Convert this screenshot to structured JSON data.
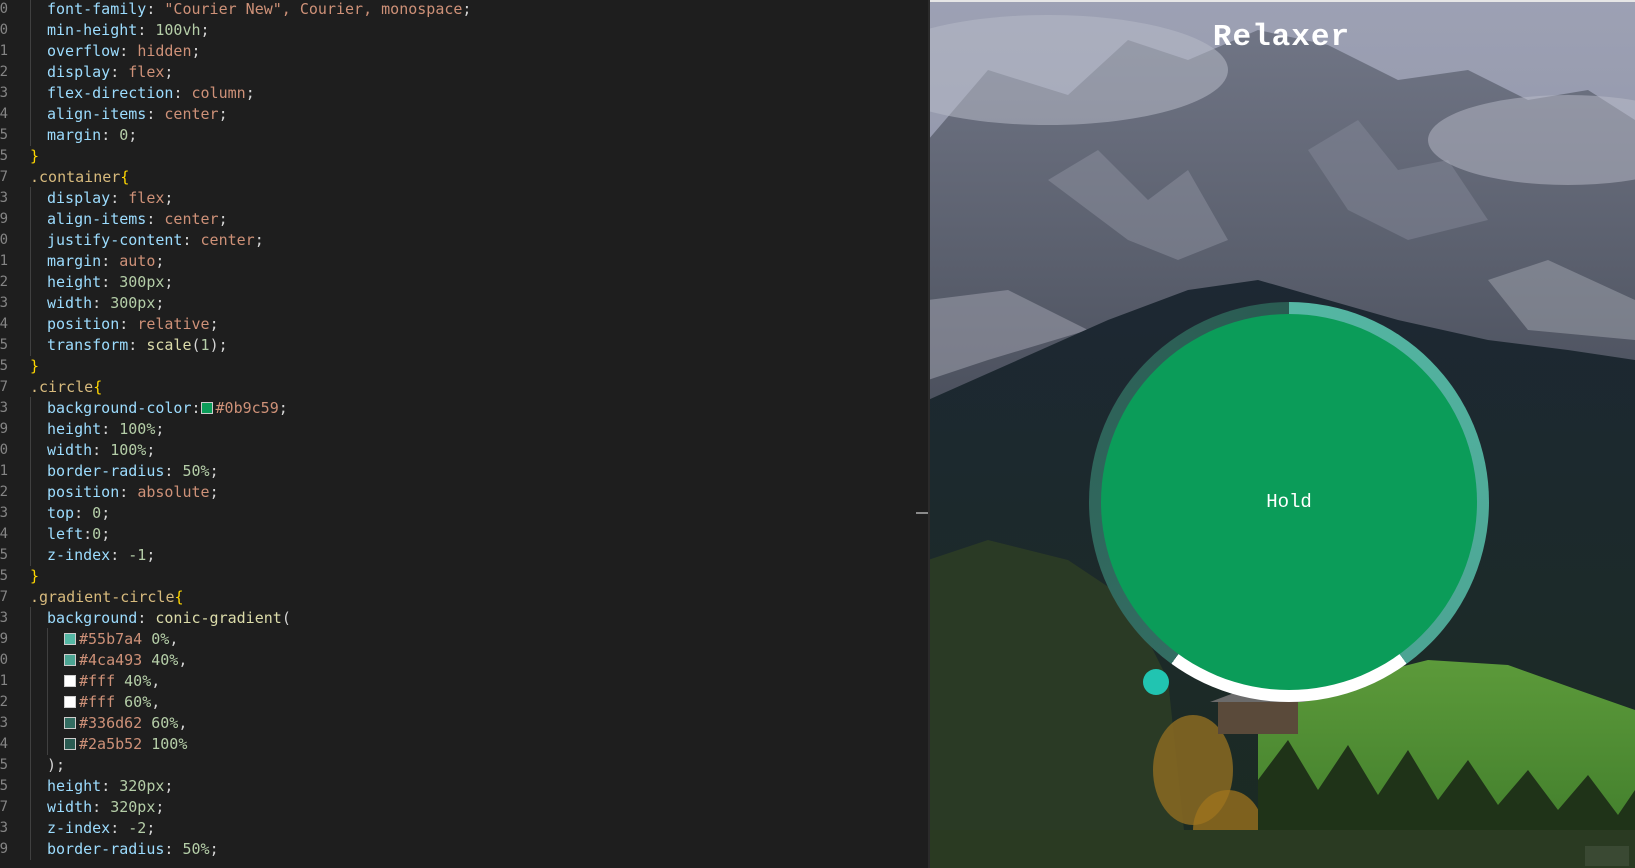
{
  "editor": {
    "lines": [
      {
        "n": "0",
        "indent": 1,
        "tokens": [
          [
            "prop",
            "font-family"
          ],
          [
            "punc",
            ": "
          ],
          [
            "val",
            "\"Courier New\", Courier, monospace"
          ],
          [
            "punc",
            ";"
          ]
        ]
      },
      {
        "n": "0",
        "indent": 1,
        "tokens": [
          [
            "prop",
            "min-height"
          ],
          [
            "punc",
            ": "
          ],
          [
            "num",
            "100vh"
          ],
          [
            "punc",
            ";"
          ]
        ]
      },
      {
        "n": "1",
        "indent": 1,
        "tokens": [
          [
            "prop",
            "overflow"
          ],
          [
            "punc",
            ": "
          ],
          [
            "val",
            "hidden"
          ],
          [
            "punc",
            ";"
          ]
        ]
      },
      {
        "n": "2",
        "indent": 1,
        "tokens": [
          [
            "prop",
            "display"
          ],
          [
            "punc",
            ": "
          ],
          [
            "val",
            "flex"
          ],
          [
            "punc",
            ";"
          ]
        ]
      },
      {
        "n": "3",
        "indent": 1,
        "tokens": [
          [
            "prop",
            "flex-direction"
          ],
          [
            "punc",
            ": "
          ],
          [
            "val",
            "column"
          ],
          [
            "punc",
            ";"
          ]
        ]
      },
      {
        "n": "4",
        "indent": 1,
        "tokens": [
          [
            "prop",
            "align-items"
          ],
          [
            "punc",
            ": "
          ],
          [
            "val",
            "center"
          ],
          [
            "punc",
            ";"
          ]
        ]
      },
      {
        "n": "5",
        "indent": 1,
        "tokens": [
          [
            "prop",
            "margin"
          ],
          [
            "punc",
            ": "
          ],
          [
            "num",
            "0"
          ],
          [
            "punc",
            ";"
          ]
        ]
      },
      {
        "n": "5",
        "indent": 0,
        "tokens": [
          [
            "brace",
            "}"
          ]
        ]
      },
      {
        "n": "7",
        "indent": 0,
        "tokens": [
          [
            "sel",
            ".container"
          ],
          [
            "brace",
            "{"
          ]
        ]
      },
      {
        "n": "3",
        "indent": 1,
        "tokens": [
          [
            "prop",
            "display"
          ],
          [
            "punc",
            ": "
          ],
          [
            "val",
            "flex"
          ],
          [
            "punc",
            ";"
          ]
        ]
      },
      {
        "n": "9",
        "indent": 1,
        "tokens": [
          [
            "prop",
            "align-items"
          ],
          [
            "punc",
            ": "
          ],
          [
            "val",
            "center"
          ],
          [
            "punc",
            ";"
          ]
        ]
      },
      {
        "n": "0",
        "indent": 1,
        "tokens": [
          [
            "prop",
            "justify-content"
          ],
          [
            "punc",
            ": "
          ],
          [
            "val",
            "center"
          ],
          [
            "punc",
            ";"
          ]
        ]
      },
      {
        "n": "1",
        "indent": 1,
        "tokens": [
          [
            "prop",
            "margin"
          ],
          [
            "punc",
            ": "
          ],
          [
            "val",
            "auto"
          ],
          [
            "punc",
            ";"
          ]
        ]
      },
      {
        "n": "2",
        "indent": 1,
        "tokens": [
          [
            "prop",
            "height"
          ],
          [
            "punc",
            ": "
          ],
          [
            "num",
            "300px"
          ],
          [
            "punc",
            ";"
          ]
        ]
      },
      {
        "n": "3",
        "indent": 1,
        "tokens": [
          [
            "prop",
            "width"
          ],
          [
            "punc",
            ": "
          ],
          [
            "num",
            "300px"
          ],
          [
            "punc",
            ";"
          ]
        ]
      },
      {
        "n": "4",
        "indent": 1,
        "tokens": [
          [
            "prop",
            "position"
          ],
          [
            "punc",
            ": "
          ],
          [
            "val",
            "relative"
          ],
          [
            "punc",
            ";"
          ]
        ]
      },
      {
        "n": "5",
        "indent": 1,
        "tokens": [
          [
            "prop",
            "transform"
          ],
          [
            "punc",
            ": "
          ],
          [
            "fn",
            "scale"
          ],
          [
            "punc",
            "("
          ],
          [
            "num",
            "1"
          ],
          [
            "punc",
            ");"
          ]
        ]
      },
      {
        "n": "5",
        "indent": 0,
        "tokens": [
          [
            "brace",
            "}"
          ]
        ]
      },
      {
        "n": "7",
        "indent": 0,
        "tokens": [
          [
            "sel",
            ".circle"
          ],
          [
            "brace",
            "{"
          ]
        ]
      },
      {
        "n": "3",
        "indent": 1,
        "tokens": [
          [
            "prop",
            "background-color"
          ],
          [
            "punc",
            ":"
          ],
          [
            "swatch",
            "#0b9c59"
          ],
          [
            "val",
            "#0b9c59"
          ],
          [
            "punc",
            ";"
          ]
        ]
      },
      {
        "n": "9",
        "indent": 1,
        "tokens": [
          [
            "prop",
            "height"
          ],
          [
            "punc",
            ": "
          ],
          [
            "num",
            "100%"
          ],
          [
            "punc",
            ";"
          ]
        ]
      },
      {
        "n": "0",
        "indent": 1,
        "tokens": [
          [
            "prop",
            "width"
          ],
          [
            "punc",
            ": "
          ],
          [
            "num",
            "100%"
          ],
          [
            "punc",
            ";"
          ]
        ]
      },
      {
        "n": "1",
        "indent": 1,
        "tokens": [
          [
            "prop",
            "border-radius"
          ],
          [
            "punc",
            ": "
          ],
          [
            "num",
            "50%"
          ],
          [
            "punc",
            ";"
          ]
        ]
      },
      {
        "n": "2",
        "indent": 1,
        "tokens": [
          [
            "prop",
            "position"
          ],
          [
            "punc",
            ": "
          ],
          [
            "val",
            "absolute"
          ],
          [
            "punc",
            ";"
          ]
        ]
      },
      {
        "n": "3",
        "indent": 1,
        "tokens": [
          [
            "prop",
            "top"
          ],
          [
            "punc",
            ": "
          ],
          [
            "num",
            "0"
          ],
          [
            "punc",
            ";"
          ]
        ]
      },
      {
        "n": "4",
        "indent": 1,
        "tokens": [
          [
            "prop",
            "left"
          ],
          [
            "punc",
            ":"
          ],
          [
            "num",
            "0"
          ],
          [
            "punc",
            ";"
          ]
        ]
      },
      {
        "n": "5",
        "indent": 1,
        "tokens": [
          [
            "prop",
            "z-index"
          ],
          [
            "punc",
            ": "
          ],
          [
            "num",
            "-1"
          ],
          [
            "punc",
            ";"
          ]
        ]
      },
      {
        "n": "5",
        "indent": 0,
        "tokens": [
          [
            "brace",
            "}"
          ]
        ]
      },
      {
        "n": "7",
        "indent": 0,
        "tokens": [
          [
            "sel",
            ".gradient-circle"
          ],
          [
            "brace",
            "{"
          ]
        ]
      },
      {
        "n": "3",
        "indent": 1,
        "tokens": [
          [
            "prop",
            "background"
          ],
          [
            "punc",
            ": "
          ],
          [
            "fn",
            "conic-gradient"
          ],
          [
            "punc",
            "("
          ]
        ]
      },
      {
        "n": "9",
        "indent": 2,
        "tokens": [
          [
            "swatch",
            "#55b7a4"
          ],
          [
            "val",
            "#55b7a4"
          ],
          [
            "punc",
            " "
          ],
          [
            "num",
            "0%"
          ],
          [
            "punc",
            ","
          ]
        ]
      },
      {
        "n": "0",
        "indent": 2,
        "tokens": [
          [
            "swatch",
            "#4ca493"
          ],
          [
            "val",
            "#4ca493"
          ],
          [
            "punc",
            " "
          ],
          [
            "num",
            "40%"
          ],
          [
            "punc",
            ","
          ]
        ]
      },
      {
        "n": "1",
        "indent": 2,
        "tokens": [
          [
            "swatch",
            "#fff"
          ],
          [
            "val",
            "#fff"
          ],
          [
            "punc",
            " "
          ],
          [
            "num",
            "40%"
          ],
          [
            "punc",
            ","
          ]
        ]
      },
      {
        "n": "2",
        "indent": 2,
        "tokens": [
          [
            "swatch",
            "#fff"
          ],
          [
            "val",
            "#fff"
          ],
          [
            "punc",
            " "
          ],
          [
            "num",
            "60%"
          ],
          [
            "punc",
            ","
          ]
        ]
      },
      {
        "n": "3",
        "indent": 2,
        "tokens": [
          [
            "swatch",
            "#336d62"
          ],
          [
            "val",
            "#336d62"
          ],
          [
            "punc",
            " "
          ],
          [
            "num",
            "60%"
          ],
          [
            "punc",
            ","
          ]
        ]
      },
      {
        "n": "4",
        "indent": 2,
        "tokens": [
          [
            "swatch",
            "#2a5b52"
          ],
          [
            "val",
            "#2a5b52"
          ],
          [
            "punc",
            " "
          ],
          [
            "num",
            "100%"
          ]
        ]
      },
      {
        "n": "5",
        "indent": 1,
        "tokens": [
          [
            "punc",
            ");"
          ]
        ]
      },
      {
        "n": "5",
        "indent": 1,
        "tokens": [
          [
            "prop",
            "height"
          ],
          [
            "punc",
            ": "
          ],
          [
            "num",
            "320px"
          ],
          [
            "punc",
            ";"
          ]
        ]
      },
      {
        "n": "7",
        "indent": 1,
        "tokens": [
          [
            "prop",
            "width"
          ],
          [
            "punc",
            ": "
          ],
          [
            "num",
            "320px"
          ],
          [
            "punc",
            ";"
          ]
        ]
      },
      {
        "n": "3",
        "indent": 1,
        "tokens": [
          [
            "prop",
            "z-index"
          ],
          [
            "punc",
            ": "
          ],
          [
            "num",
            "-2"
          ],
          [
            "punc",
            ";"
          ]
        ]
      },
      {
        "n": "9",
        "indent": 1,
        "tokens": [
          [
            "prop",
            "border-radius"
          ],
          [
            "punc",
            ": "
          ],
          [
            "num",
            "50%"
          ],
          [
            "punc",
            ";"
          ]
        ]
      }
    ]
  },
  "preview": {
    "title": "Relaxer",
    "breath_text": "Hold"
  },
  "colors": {
    "circle": "#0b9c59",
    "ring_light": "#55b7a4",
    "ring_mid": "#4ca493",
    "ring_white": "#ffffff",
    "ring_dark1": "#336d62",
    "ring_dark2": "#2a5b52",
    "pointer": "#21c4b1",
    "editor_bg": "#1e1e1e"
  }
}
